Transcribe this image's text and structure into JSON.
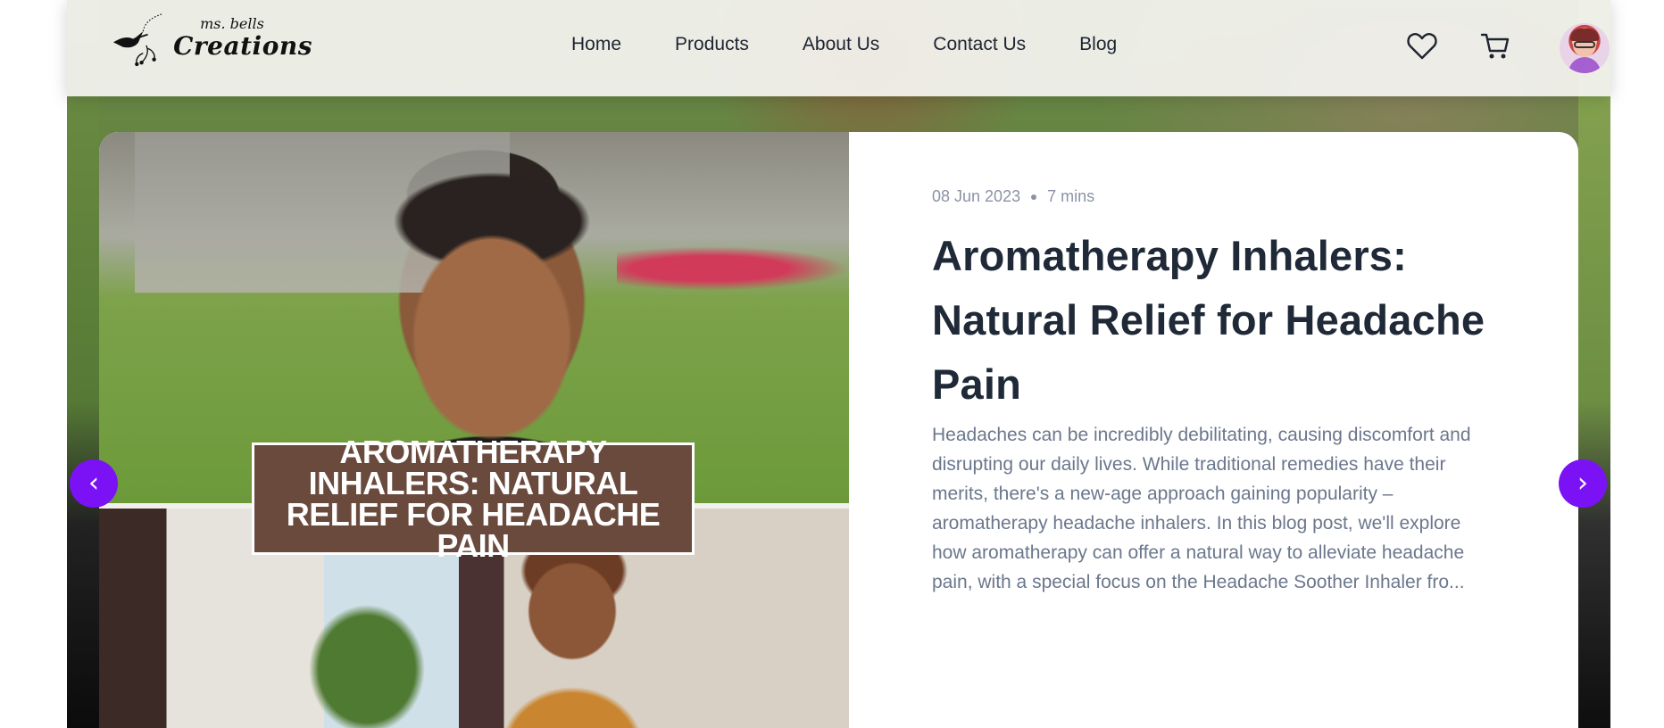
{
  "brand": {
    "logo_small": "ms. bells",
    "logo_big": "Creations"
  },
  "nav": {
    "items": [
      {
        "label": "Home"
      },
      {
        "label": "Products"
      },
      {
        "label": "About Us"
      },
      {
        "label": "Contact Us"
      },
      {
        "label": "Blog"
      }
    ]
  },
  "header_icons": {
    "wishlist": "heart-icon",
    "cart": "cart-icon",
    "profile": "avatar"
  },
  "post": {
    "image_banner": "AROMATHERAPY INHALERS: NATURAL RELIEF FOR HEADACHE PAIN",
    "date": "08 Jun 2023",
    "read_time": "7 mins",
    "title": "Aromatherapy Inhalers: Natural Relief for Headache Pain",
    "excerpt": "Headaches can be incredibly debilitating, causing discomfort and disrupting our daily lives. While traditional remedies have their merits, there's a new-age approach gaining popularity – aromatherapy headache inhalers. In this blog post, we'll explore how aromatherapy can offer a natural way to alleviate headache pain, with a special focus on the Headache Soother Inhaler fro..."
  },
  "carousel": {
    "prev_symbol": "‹",
    "next_symbol": "›"
  },
  "colors": {
    "accent": "#7b12f5",
    "title": "#1f2937",
    "muted": "#8a93a6",
    "banner": "#6b4a3e"
  }
}
